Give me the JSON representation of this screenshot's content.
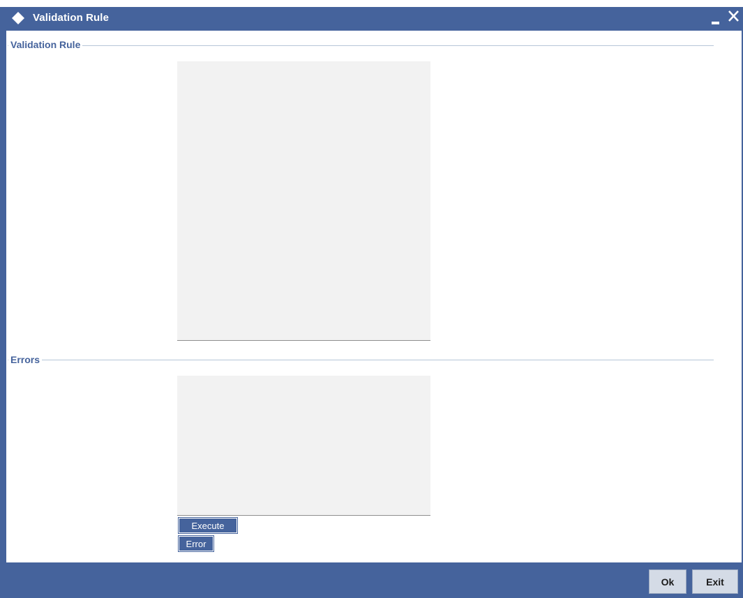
{
  "window": {
    "title": "Validation Rule"
  },
  "sections": {
    "validation_rule": {
      "legend": "Validation Rule",
      "textarea_value": ""
    },
    "errors": {
      "legend": "Errors",
      "textarea_value": ""
    }
  },
  "buttons": {
    "execute_label": "Execute",
    "error_label": "Error"
  },
  "footer": {
    "ok_label": "Ok",
    "exit_label": "Exit"
  },
  "icons": {
    "title": "diamond-icon",
    "minimize": "minimize-icon",
    "close": "close-icon"
  },
  "colors": {
    "accent": "#45639c",
    "textarea_bg": "#f2f2f2",
    "footer_button_bg": "#d4dbe6"
  }
}
